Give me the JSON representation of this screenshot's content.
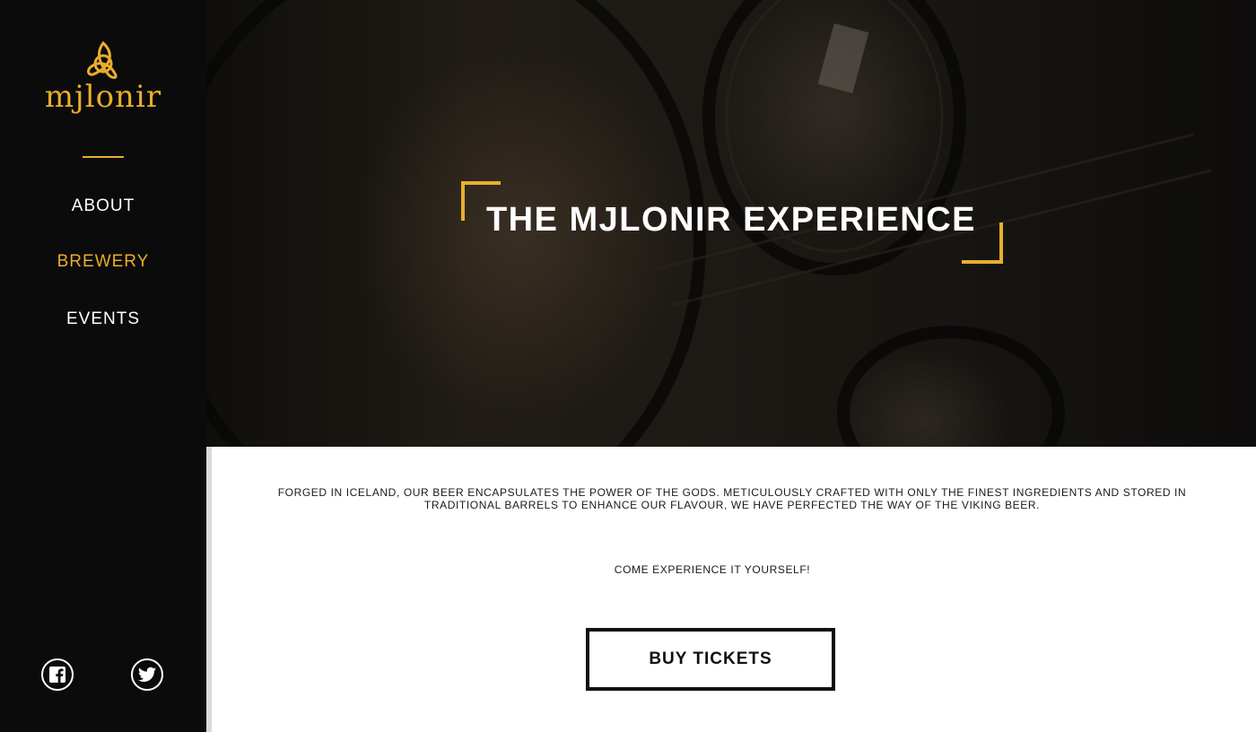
{
  "brand": {
    "name": "mjlonir",
    "accent_color": "#e9ae2b",
    "icon": "triquetra-icon"
  },
  "nav": {
    "items": [
      {
        "label": "ABOUT",
        "active": false
      },
      {
        "label": "BREWERY",
        "active": true
      },
      {
        "label": "EVENTS",
        "active": false
      }
    ]
  },
  "social": [
    {
      "icon": "facebook-icon"
    },
    {
      "icon": "twitter-icon"
    }
  ],
  "hero": {
    "title": "THE MJLONIR EXPERIENCE"
  },
  "content": {
    "description": "FORGED IN ICELAND, OUR BEER ENCAPSULATES THE POWER OF THE GODS. METICULOUSLY CRAFTED WITH ONLY THE FINEST INGREDIENTS AND STORED IN TRADITIONAL BARRELS TO ENHANCE OUR FLAVOUR, WE HAVE PERFECTED THE WAY OF THE VIKING BEER.",
    "cta_text": "COME EXPERIENCE IT YOURSELF!",
    "button_label": "BUY TICKETS"
  }
}
